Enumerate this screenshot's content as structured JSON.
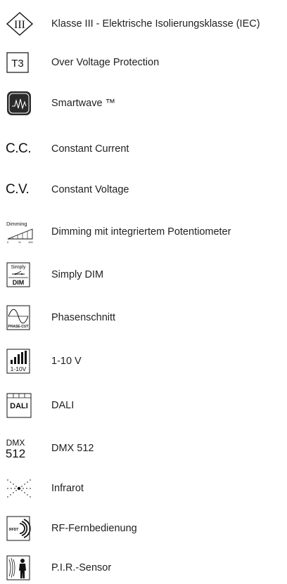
{
  "items": [
    {
      "icon": "class-iii-icon",
      "icon_text": "III",
      "label": "Klasse III - Elektrische Isolierungsklasse (IEC)"
    },
    {
      "icon": "t3-icon",
      "icon_text": "T3",
      "label": "Over Voltage Protection"
    },
    {
      "icon": "smartwave-icon",
      "label": "Smartwave ™"
    },
    {
      "icon": "constant-current-icon",
      "icon_text": "C.C.",
      "label": "Constant Current"
    },
    {
      "icon": "constant-voltage-icon",
      "icon_text": "C.V.",
      "label": "Constant Voltage"
    },
    {
      "icon": "dimming-potentiometer-icon",
      "icon_text": "Dimming",
      "icon_scale": [
        "0",
        "%",
        "100"
      ],
      "label": "Dimming mit integriertem Potentiometer"
    },
    {
      "icon": "simply-dim-icon",
      "icon_text": [
        "Simply",
        "DIM"
      ],
      "label": "Simply DIM"
    },
    {
      "icon": "phase-cut-icon",
      "icon_text": "PHASE-CUT",
      "label": "Phasenschnitt"
    },
    {
      "icon": "1-10v-icon",
      "icon_text": "1-10V",
      "label": "1-10 V"
    },
    {
      "icon": "dali-icon",
      "icon_text": "DALI",
      "label": "DALI"
    },
    {
      "icon": "dmx-512-icon",
      "icon_text": [
        "DMX",
        "512"
      ],
      "label": "DMX 512"
    },
    {
      "icon": "infrared-icon",
      "label": "Infrarot"
    },
    {
      "icon": "rf-remote-icon",
      "icon_text": "RFDT",
      "label": "RF-Fernbedienung"
    },
    {
      "icon": "pir-sensor-icon",
      "label": "P.I.R.-Sensor"
    }
  ]
}
